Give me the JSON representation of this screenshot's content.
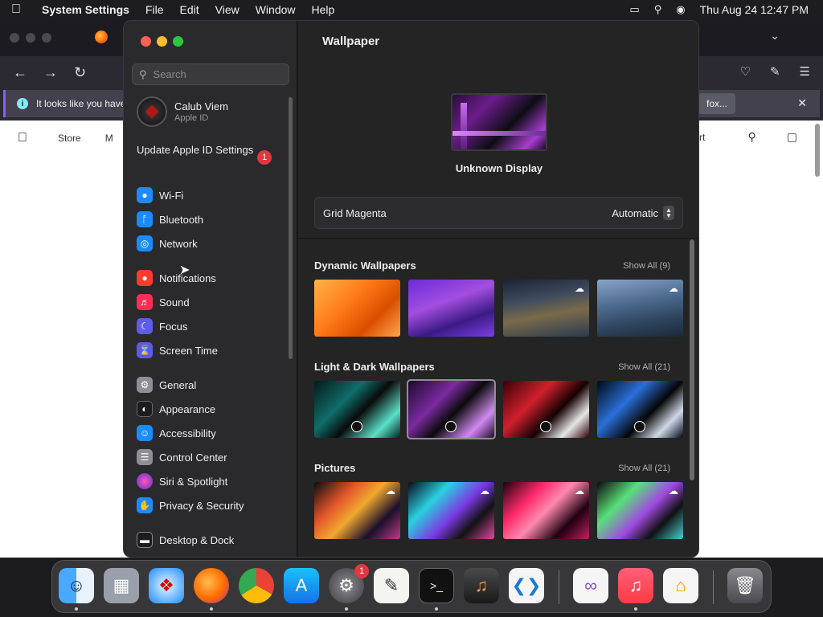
{
  "menubar": {
    "app_name": "System Settings",
    "items": [
      "File",
      "Edit",
      "View",
      "Window",
      "Help"
    ],
    "datetime": "Thu Aug 24  12:47 PM"
  },
  "browser": {
    "notice_text": "It looks like you have",
    "notice_button": "fox...",
    "page_nav": {
      "store": "Store",
      "m": "M",
      "rt": "rt"
    }
  },
  "settings": {
    "search_placeholder": "Search",
    "user": {
      "name": "Calub Viem",
      "subtitle": "Apple ID"
    },
    "update": {
      "label": "Update Apple ID Settings",
      "badge": "1"
    },
    "sidebar_items": [
      {
        "label": "Wi-Fi",
        "icon": "wifi-icon",
        "color": "#1a8cff"
      },
      {
        "label": "Bluetooth",
        "icon": "bluetooth-icon",
        "color": "#1a8cff"
      },
      {
        "label": "Network",
        "icon": "globe-icon",
        "color": "#1a8cff"
      },
      {
        "label": "Notifications",
        "icon": "bell-icon",
        "color": "#ff3b30"
      },
      {
        "label": "Sound",
        "icon": "speaker-icon",
        "color": "#ff2d55"
      },
      {
        "label": "Focus",
        "icon": "moon-icon",
        "color": "#5e5ce6"
      },
      {
        "label": "Screen Time",
        "icon": "hourglass-icon",
        "color": "#5e5ce6"
      },
      {
        "label": "General",
        "icon": "gear-icon",
        "color": "#8e8e93"
      },
      {
        "label": "Appearance",
        "icon": "appearance-icon",
        "color": "#1c1c1e"
      },
      {
        "label": "Accessibility",
        "icon": "accessibility-icon",
        "color": "#1a8cff"
      },
      {
        "label": "Control Center",
        "icon": "toggles-icon",
        "color": "#8e8e93"
      },
      {
        "label": "Siri & Spotlight",
        "icon": "siri-icon",
        "color": "#c03adf"
      },
      {
        "label": "Privacy & Security",
        "icon": "hand-icon",
        "color": "#1a8cff"
      },
      {
        "label": "Desktop & Dock",
        "icon": "dock-icon",
        "color": "#1c1c1e"
      }
    ],
    "content": {
      "title": "Wallpaper",
      "display_name": "Unknown Display",
      "wallpaper_name": "Grid Magenta",
      "wallpaper_mode": "Automatic",
      "sections": [
        {
          "title": "Dynamic Wallpapers",
          "show_all": "Show All (9)"
        },
        {
          "title": "Light & Dark Wallpapers",
          "show_all": "Show All (21)"
        },
        {
          "title": "Pictures",
          "show_all": "Show All (21)"
        }
      ]
    }
  },
  "dock": {
    "apps": [
      "finder",
      "launchpad",
      "safari",
      "firefox",
      "chrome",
      "app-store",
      "system-settings",
      "textedit",
      "terminal",
      "garageband",
      "vscode",
      "visual-studio",
      "music",
      "home",
      "trash"
    ],
    "settings_badge": "1"
  }
}
